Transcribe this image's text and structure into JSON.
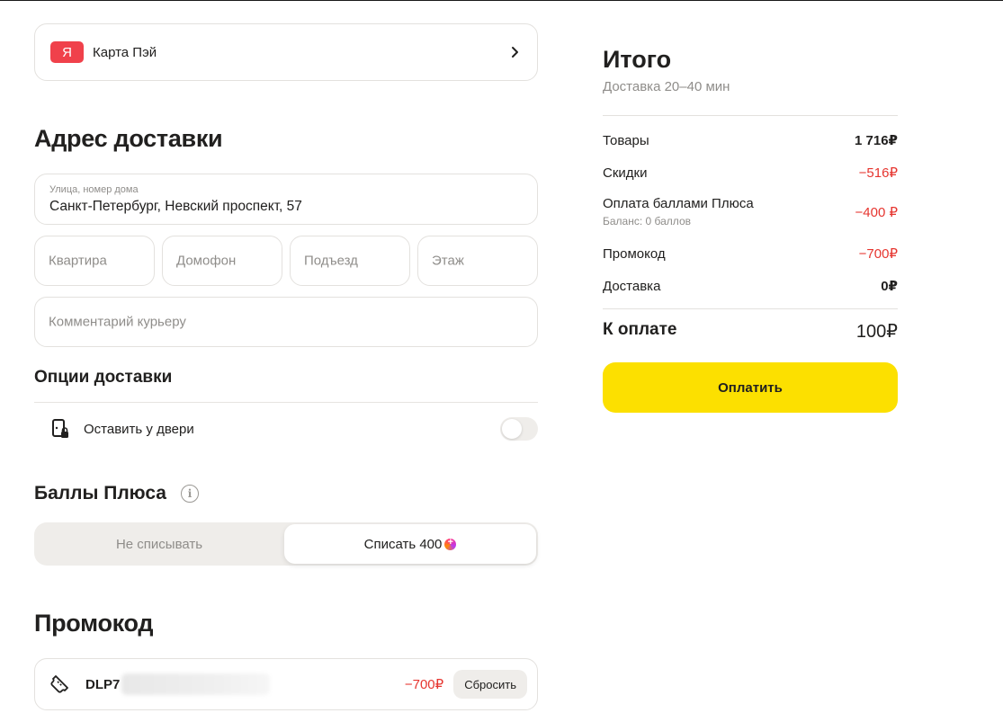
{
  "payment": {
    "logo_letter": "Я",
    "label": "Карта Пэй",
    "chevron": "chevron-right-icon"
  },
  "address": {
    "heading": "Адрес доставки",
    "street_label": "Улица, номер дома",
    "street_value": "Санкт-Петербург, Невский проспект, 57",
    "apartment_placeholder": "Квартира",
    "intercom_placeholder": "Домофон",
    "entrance_placeholder": "Подъезд",
    "floor_placeholder": "Этаж",
    "comment_placeholder": "Комментарий курьеру"
  },
  "delivery_options": {
    "heading": "Опции доставки",
    "leave_at_door_label": "Оставить у двери",
    "leave_at_door_enabled": false
  },
  "plus_points": {
    "heading": "Баллы Плюса",
    "info_icon": "i",
    "option_off": "Не списывать",
    "option_on": "Списать 400",
    "selected": "option_on"
  },
  "promo": {
    "heading": "Промокод",
    "code_visible": "DLP7",
    "amount": "−700₽",
    "reset_label": "Сбросить"
  },
  "summary": {
    "title": "Итого",
    "subtitle": "Доставка 20–40 мин",
    "rows": [
      {
        "label": "Товары",
        "value": "1 716₽"
      },
      {
        "label": "Скидки",
        "value": "−516₽"
      },
      {
        "label": "Оплата баллами Плюса",
        "sub": "Баланс: 0 баллов",
        "value": "−400 ₽"
      },
      {
        "label": "Промокод",
        "value": "−700₽"
      },
      {
        "label": "Доставка",
        "value": "0₽"
      }
    ],
    "total_label": "К оплате",
    "total_value": "100₽",
    "pay_button": "Оплатить"
  },
  "colors": {
    "accent_yellow": "#fce000",
    "negative_red": "#e6352f",
    "ya_red": "#f0414b"
  }
}
